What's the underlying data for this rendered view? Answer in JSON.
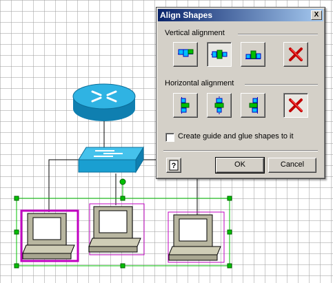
{
  "dialog": {
    "title": "Align Shapes",
    "close_glyph": "X",
    "vertical_label": "Vertical alignment",
    "horizontal_label": "Horizontal alignment",
    "vertical_buttons": [
      {
        "icon": "align-top-icon",
        "state": "normal"
      },
      {
        "icon": "align-middle-icon",
        "state": "pressed"
      },
      {
        "icon": "align-bottom-icon",
        "state": "normal"
      },
      {
        "icon": "no-align-x-icon",
        "state": "normal"
      }
    ],
    "horizontal_buttons": [
      {
        "icon": "align-left-icon",
        "state": "normal"
      },
      {
        "icon": "align-center-icon",
        "state": "normal"
      },
      {
        "icon": "align-right-icon",
        "state": "normal"
      },
      {
        "icon": "no-align-x-icon",
        "state": "pressed"
      }
    ],
    "checkbox_label": "Create guide and glue shapes to it",
    "checkbox_checked": false,
    "help_glyph": "?",
    "ok_label": "OK",
    "cancel_label": "Cancel"
  },
  "diagram": {
    "shapes": [
      "router",
      "switch",
      "computer",
      "computer",
      "computer"
    ],
    "selected_count": 3
  },
  "colors": {
    "title_start": "#0a246a",
    "title_end": "#a6caf0",
    "network_blue": "#1a9fd1",
    "selection_green": "#00c000",
    "selection_magenta": "#c000c0",
    "x_red": "#c00000"
  }
}
